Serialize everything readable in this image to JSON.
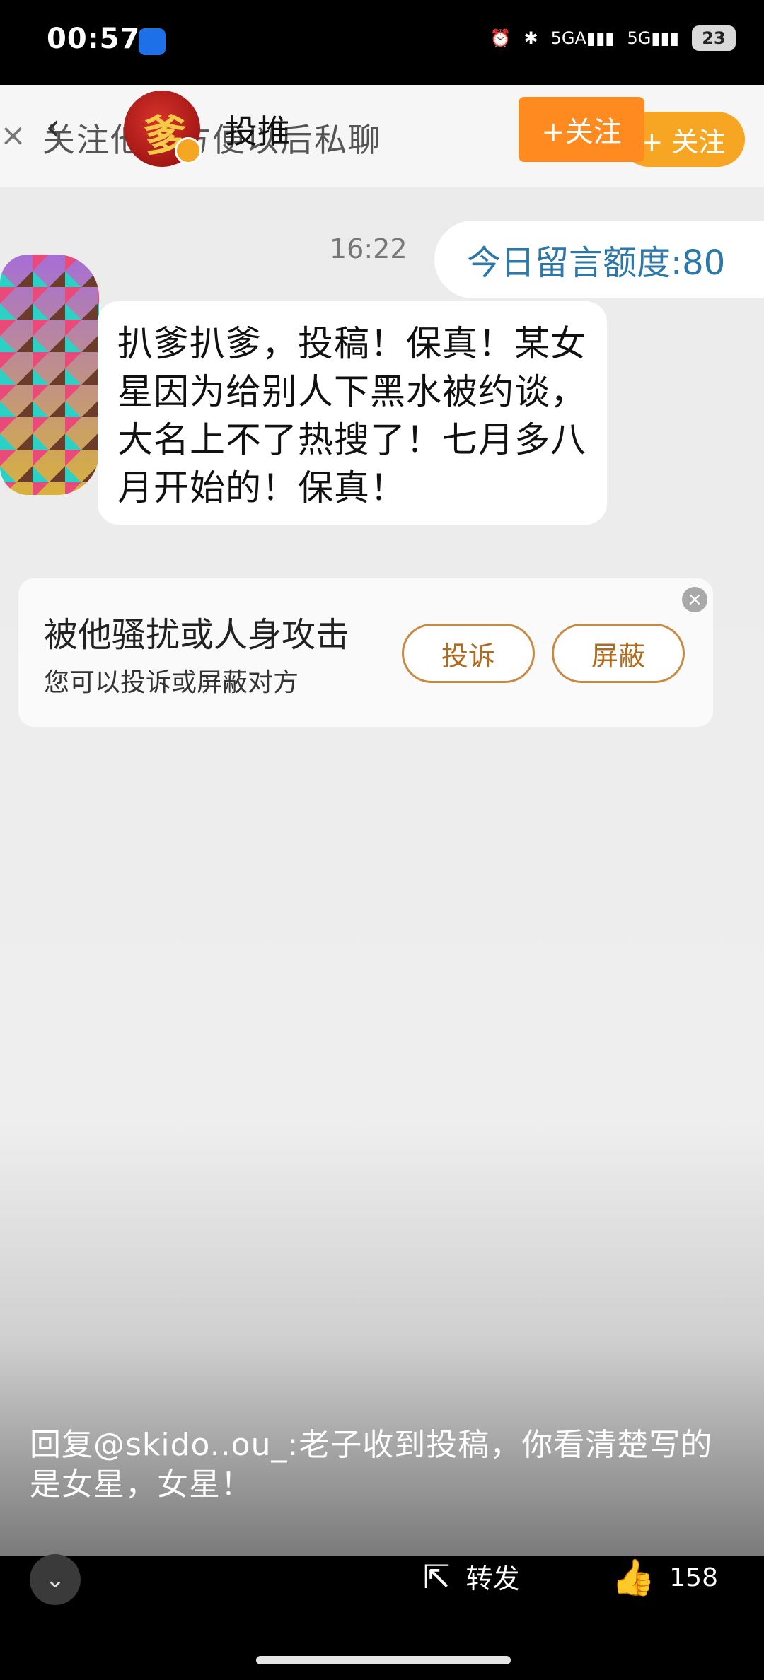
{
  "status_bar": {
    "time": "00:57",
    "signal1": "5GA",
    "signal2": "5G",
    "battery": "23"
  },
  "header": {
    "close_icon": "close-icon",
    "hint_text": "关注他，方便以后私聊",
    "username": "投推",
    "follow_label": "+关注",
    "follow_label_2": "+ 关注"
  },
  "chat": {
    "timestamp": "16:22",
    "quota_text": "今日留言额度:80",
    "message": "扒爹扒爹，投稿！保真！某女星因为给别人下黑水被约谈，大名上不了热搜了！七月多八月开始的！保真！"
  },
  "report_card": {
    "title": "被他骚扰或人身攻击",
    "subtitle": "您可以投诉或屏蔽对方",
    "complain_label": "投诉",
    "block_label": "屏蔽"
  },
  "reply_caption": "回复@skido..ou_:老子收到投稿，你看清楚写的是女星，女星！",
  "bottom": {
    "share_label": "转发",
    "like_count": "158"
  }
}
